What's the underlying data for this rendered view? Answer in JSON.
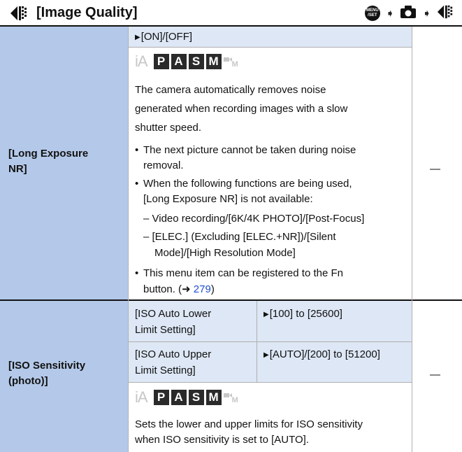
{
  "header": {
    "title": "[Image Quality]",
    "menu_icon_top": "MENU",
    "menu_icon_bottom": "/SET"
  },
  "mode_icons": {
    "ia": "iA",
    "p": "P",
    "a": "A",
    "s": "S",
    "m": "M",
    "movie_m": "M"
  },
  "rows": [
    {
      "label_line1": "[Long Exposure",
      "label_line2": "NR]",
      "setting": "[ON]/[OFF]",
      "desc_lines": [
        "The camera automatically removes noise",
        "generated when recording images with a slow",
        "shutter speed."
      ],
      "b1_lines": [
        "The next picture cannot be taken during noise",
        "removal."
      ],
      "b2_lines": [
        "When the following functions are being used,",
        "[Long Exposure NR] is not available:"
      ],
      "sub1": "– Video recording/[6K/4K PHOTO]/[Post-Focus]",
      "sub2_lines": [
        "– [ELEC.] (Excluding [ELEC.+NR])/[Silent",
        "Mode]/[High Resolution Mode]"
      ],
      "b3_lines": [
        "This menu item can be registered to the Fn",
        "button. (➜ "
      ],
      "b3_link": "279",
      "b3_end": ")",
      "right": "—"
    },
    {
      "label_line1": "[ISO Sensitivity",
      "label_line2": "(photo)]",
      "sub_rows": [
        {
          "name_line1": "[ISO Auto Lower",
          "name_line2": "Limit Setting]",
          "value": "[100] to [25600]"
        },
        {
          "name_line1": "[ISO Auto Upper",
          "name_line2": "Limit Setting]",
          "value": "[AUTO]/[200] to [51200]"
        }
      ],
      "desc_lines": [
        "Sets the lower and upper limits for ISO sensitivity",
        "when ISO sensitivity is set to [AUTO]."
      ],
      "right": "—"
    }
  ]
}
